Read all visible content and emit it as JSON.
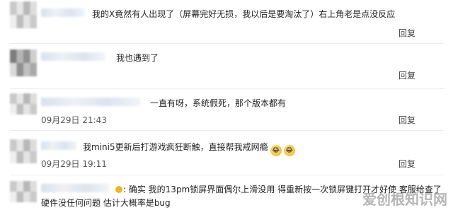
{
  "comments": [
    {
      "text": "我的X竟然有人出现了（屏幕完好无损，我以后是要淘汰了）右上角老是点没反应",
      "time": "",
      "reply": "回复"
    },
    {
      "text": "我也遇到了",
      "time": "",
      "reply": "回复"
    },
    {
      "text": "一直有呀，系统假死，那个版本都有",
      "time": "09月29日 21:43",
      "reply": "回复"
    },
    {
      "text": "我mini5更新后打游戏疯狂断触，直接帮我戒网瘾",
      "time": "09月29日 19:11",
      "reply": "回复"
    },
    {
      "text_line1": "确实 我的13pm锁屏界面偶尔上滑没用 得重新按一次锁屏键打开才好使 客服给查了",
      "text_line2": "硬件没任何问题 估计大概率是bug",
      "time": "",
      "reply": "回复"
    }
  ],
  "icons": {
    "emoji": "laughing-crying-emoji"
  },
  "watermark": "爱创根知识网"
}
